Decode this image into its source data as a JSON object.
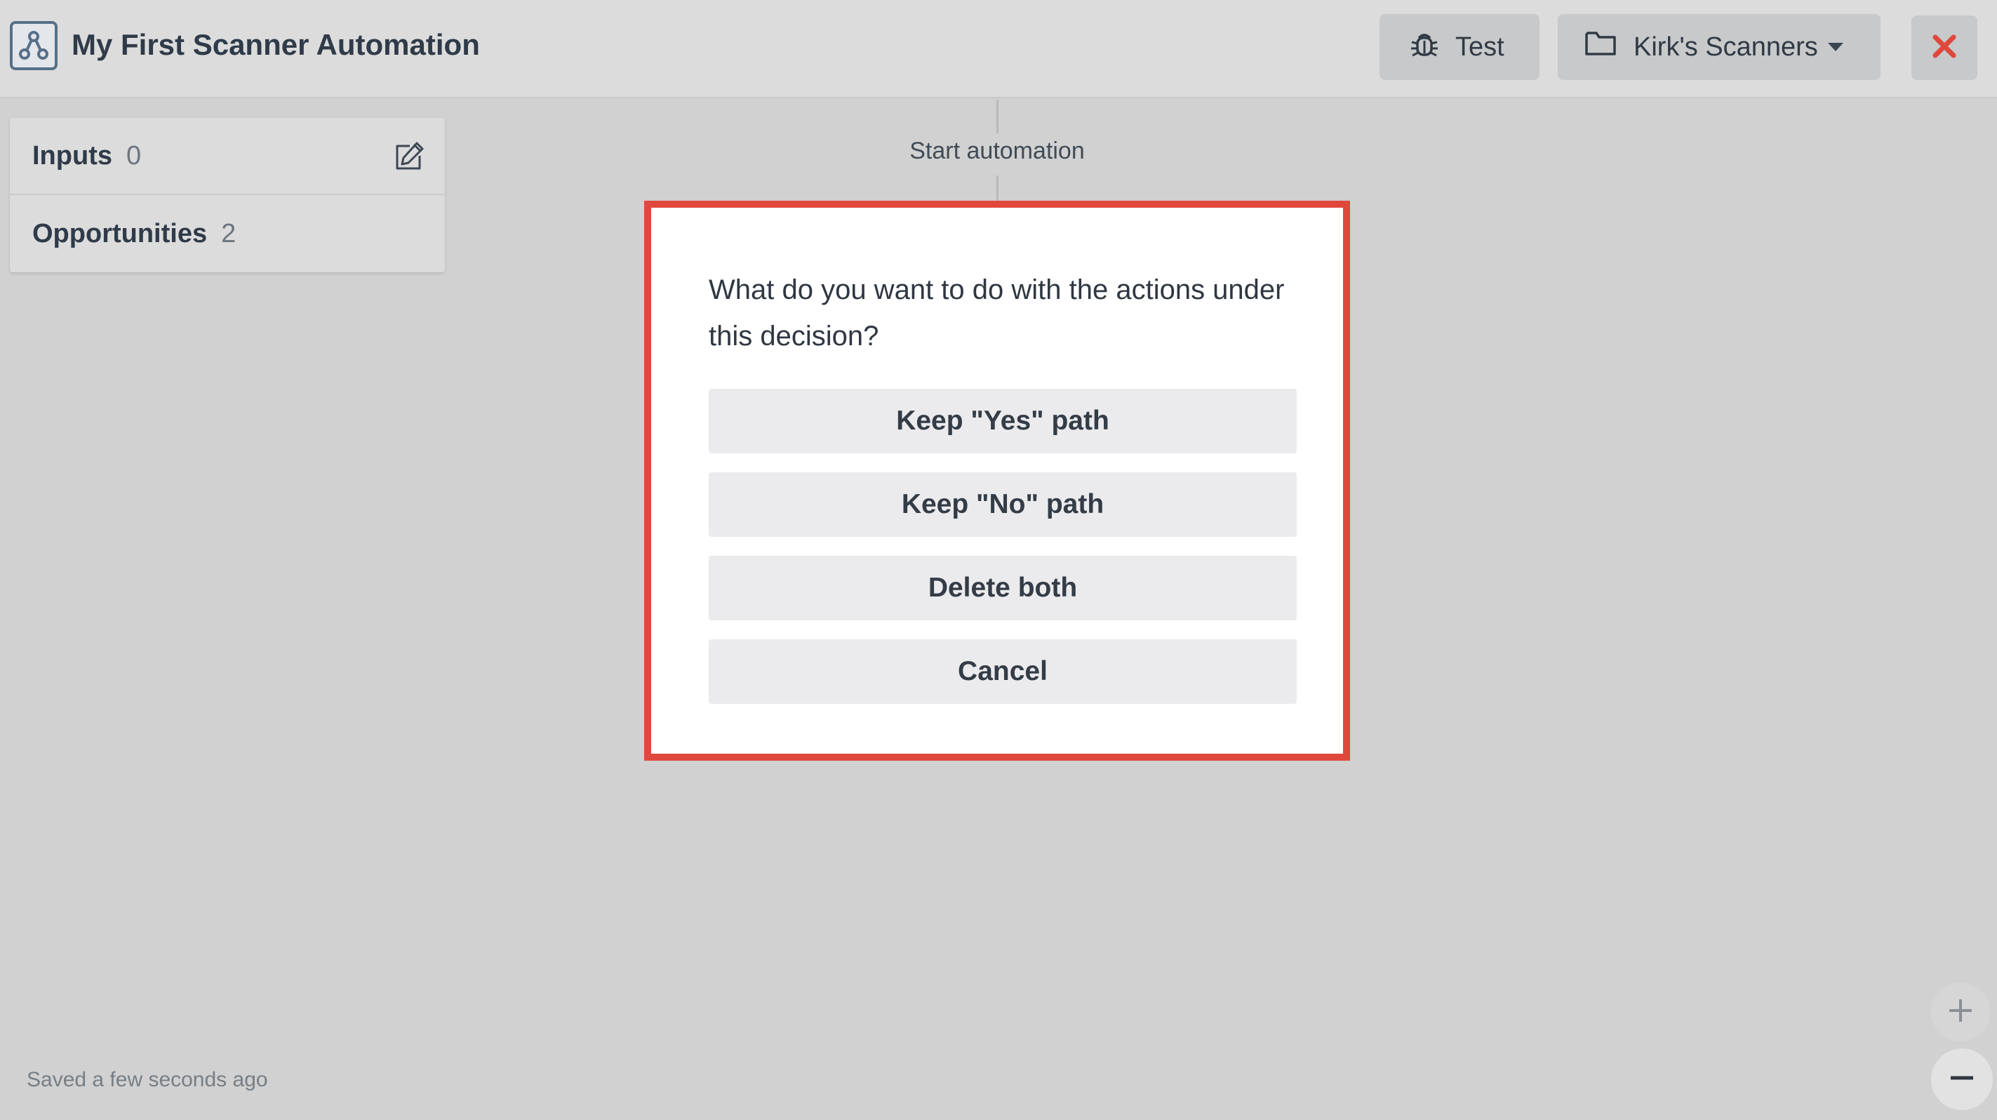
{
  "header": {
    "app_icon": "automation-flow-icon",
    "title": "My First Scanner Automation",
    "test_label": "Test",
    "test_icon": "bug-icon",
    "folder_label": "Kirk's Scanners",
    "folder_icon": "folder-icon",
    "close_icon": "close-icon",
    "close_color": "#e0483d"
  },
  "sidebar": {
    "items": [
      {
        "label": "Inputs",
        "count": "0",
        "icon": "edit-icon"
      },
      {
        "label": "Opportunities",
        "count": "2"
      }
    ]
  },
  "canvas": {
    "start_label": "Start automation"
  },
  "dialog": {
    "question": "What do you want to do with the actions under this decision?",
    "options": [
      "Keep \"Yes\" path",
      "Keep \"No\" path",
      "Delete both",
      "Cancel"
    ],
    "highlight_color": "#e0483d"
  },
  "footer": {
    "saved_status": "Saved a few seconds ago",
    "zoom_in_icon": "plus-icon",
    "zoom_out_icon": "minus-icon"
  }
}
